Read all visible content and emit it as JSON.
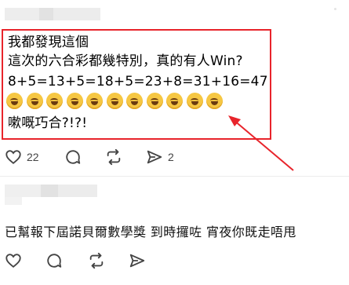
{
  "post": {
    "line1": "我都發現這個",
    "line2": "這次的六合彩都幾特別，真的有人Win?",
    "line3": "8+5=13+5=18+5=23+8=31+16=47",
    "emoji_name": "rolling-on-floor-laughing",
    "emoji_count": 11,
    "line5": "嗽嘅巧合?!?!"
  },
  "actions": {
    "like_count": "22",
    "share_count": "2"
  },
  "reply": {
    "text": "已幫報下屆諾貝爾數學獎 到時攞咗 宵夜你既走唔甩"
  },
  "colors": {
    "highlight": "#e8242b",
    "icon": "#444444"
  }
}
